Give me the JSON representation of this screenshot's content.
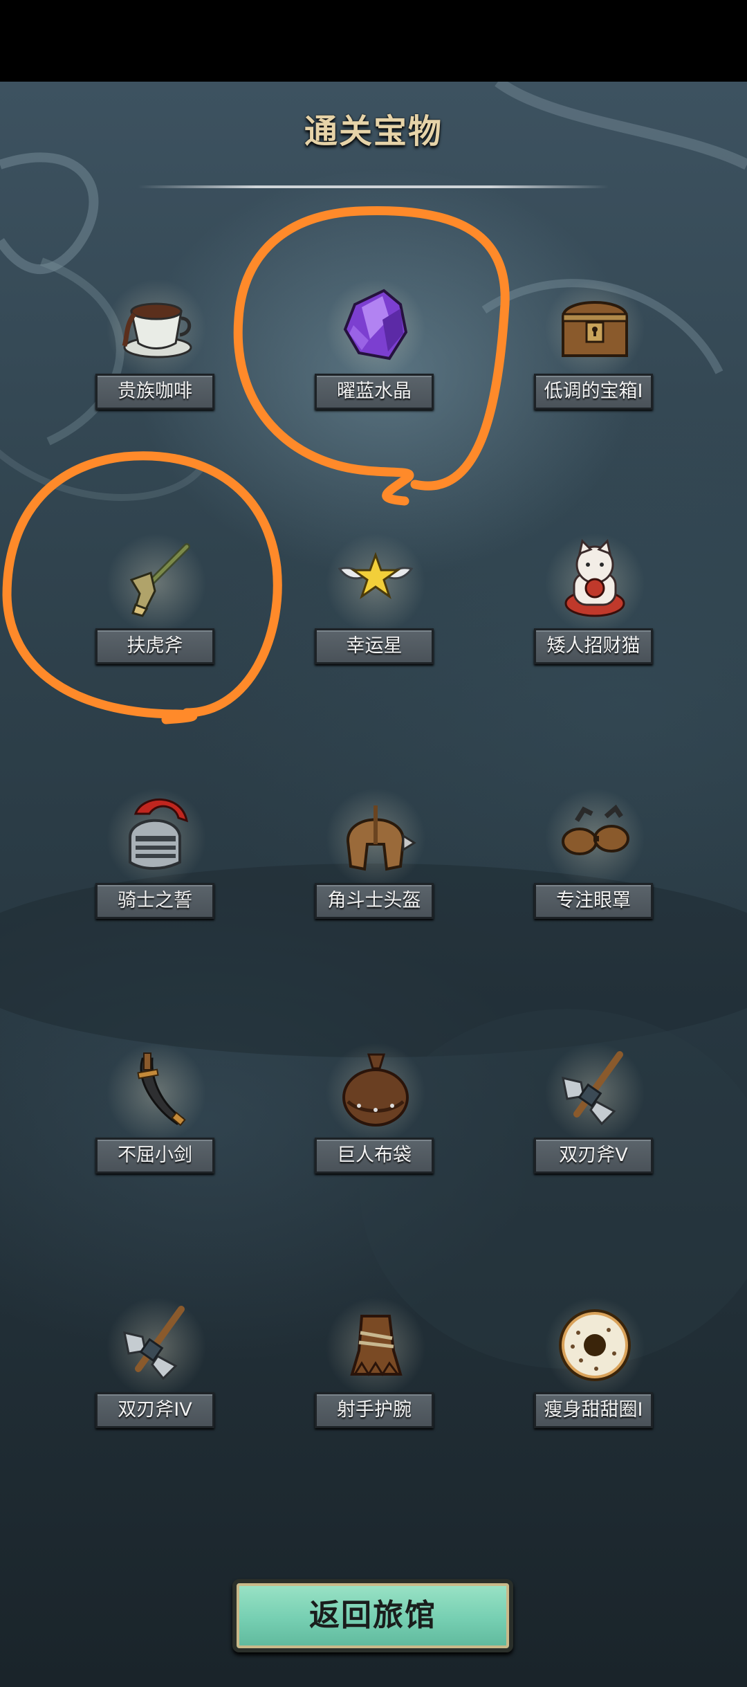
{
  "title": "通关宝物",
  "items": [
    {
      "name": "贵族咖啡",
      "icon": "coffee-cup-icon"
    },
    {
      "name": "曜蓝水晶",
      "icon": "purple-crystal-icon"
    },
    {
      "name": "低调的宝箱I",
      "icon": "treasure-chest-icon"
    },
    {
      "name": "扶虎斧",
      "icon": "tiger-axe-icon"
    },
    {
      "name": "幸运星",
      "icon": "winged-star-icon"
    },
    {
      "name": "矮人招财猫",
      "icon": "lucky-cat-icon"
    },
    {
      "name": "骑士之誓",
      "icon": "knight-helmet-icon"
    },
    {
      "name": "角斗士头盔",
      "icon": "gladiator-helmet-icon"
    },
    {
      "name": "专注眼罩",
      "icon": "goggles-icon"
    },
    {
      "name": "不屈小剑",
      "icon": "short-sword-icon"
    },
    {
      "name": "巨人布袋",
      "icon": "cloth-sack-icon"
    },
    {
      "name": "双刃斧V",
      "icon": "double-axe-icon"
    },
    {
      "name": "双刃斧IV",
      "icon": "double-axe-icon"
    },
    {
      "name": "射手护腕",
      "icon": "archer-bracer-icon"
    },
    {
      "name": "瘦身甜甜圈I",
      "icon": "donut-icon"
    }
  ],
  "back_button": {
    "label": "返回旅馆"
  },
  "colors": {
    "annotation": "#ff8a2a",
    "button": "#7fd6b8",
    "title": "#e6d3a8"
  }
}
